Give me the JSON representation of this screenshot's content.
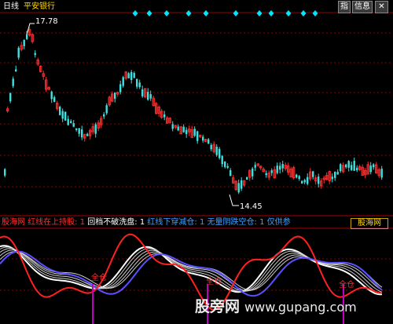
{
  "header": {
    "period": "日线",
    "stock_name": "平安银行",
    "btn_indicator": "指",
    "btn_info": "信息"
  },
  "price_labels": {
    "high": "17.78",
    "low": "14.45"
  },
  "indicator_bar": {
    "items": [
      {
        "text": "股海网",
        "color": "#ff3030"
      },
      {
        "text": "红线在上持股: 1",
        "color": "#ff3030"
      },
      {
        "text": "回档不破洗盘: 1",
        "color": "#ffffff"
      },
      {
        "text": "红线下穿减仓: 1",
        "color": "#40a0ff"
      },
      {
        "text": "无量阴跌空仓: 1",
        "color": "#40a0ff"
      },
      {
        "text": "仅供参",
        "color": "#40a0ff"
      }
    ],
    "logo": "股海网"
  },
  "annotations": [
    "全仓",
    "全仓",
    "全仓"
  ],
  "watermark": {
    "brand": "股旁网",
    "url": "www.gupang.com"
  },
  "colors": {
    "up": "#ff3030",
    "down": "#40e0e0",
    "grid": "#8b0000",
    "marker": "#00e5ff",
    "indicator_red": "#ff2020",
    "indicator_blue": "#5a50ff",
    "signal_bar": "#c000c0"
  }
}
